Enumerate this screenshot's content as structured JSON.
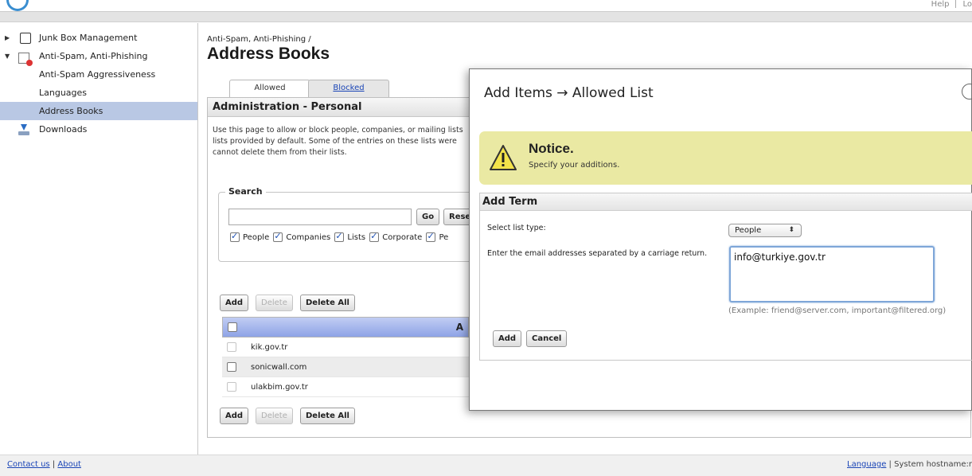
{
  "header": {
    "links": [
      "Help",
      "Lo"
    ]
  },
  "sidebar": {
    "items": [
      {
        "label": "Junk Box Management",
        "expanded": false,
        "icon": "book-icon"
      },
      {
        "label": "Anti-Spam, Anti-Phishing",
        "expanded": true,
        "icon": "envelope-blocked-icon"
      },
      {
        "label": "Anti-Spam Aggressiveness"
      },
      {
        "label": "Languages"
      },
      {
        "label": "Address Books",
        "active": true
      },
      {
        "label": "Downloads",
        "icon": "download-icon"
      }
    ]
  },
  "main": {
    "breadcrumb": "Anti-Spam, Anti-Phishing /",
    "title": "Address Books",
    "tabs": [
      {
        "label": "Allowed",
        "active": true
      },
      {
        "label": "Blocked",
        "active": false
      }
    ],
    "panel_title": "Administration - Personal",
    "description_lines": [
      "Use this page to allow or block people, companies, or mailing lists",
      "lists provided by default.  Some of the entries on these lists were",
      "cannot delete them from their lists."
    ],
    "search": {
      "legend": "Search",
      "value": "",
      "go_label": "Go",
      "reset_label": "Reset",
      "filters": [
        {
          "label": "People",
          "checked": true
        },
        {
          "label": "Companies",
          "checked": true
        },
        {
          "label": "Lists",
          "checked": true
        },
        {
          "label": "Corporate",
          "checked": true
        },
        {
          "label": "Pe",
          "checked": false
        }
      ]
    },
    "actions": {
      "add": "Add",
      "delete": "Delete",
      "delete_all": "Delete All"
    },
    "table": {
      "header_partial": "A",
      "rows": [
        "kik.gov.tr",
        "sonicwall.com",
        "ulakbim.gov.tr"
      ]
    }
  },
  "modal": {
    "title": "Add Items → Allowed List",
    "notice_title": "Notice.",
    "notice_text": "Specify your additions.",
    "section_title": "Add Term",
    "list_type_label": "Select list type:",
    "list_type_value": "People",
    "emails_label": "Enter the email addresses separated by a carriage return.",
    "emails_value": "info@turkiye.gov.tr",
    "example": "(Example: friend@server.com, important@filtered.org)",
    "add_label": "Add",
    "cancel_label": "Cancel"
  },
  "footer": {
    "contact": "Contact us",
    "separator": "|",
    "about": "About",
    "language": "Language",
    "hostname": "| System hostname:r"
  },
  "colors": {
    "accent_blue": "#1a45b6",
    "active_nav": "#b9c8e4",
    "table_header": "#9fb1ea",
    "notice_bg": "#eae9a3"
  }
}
